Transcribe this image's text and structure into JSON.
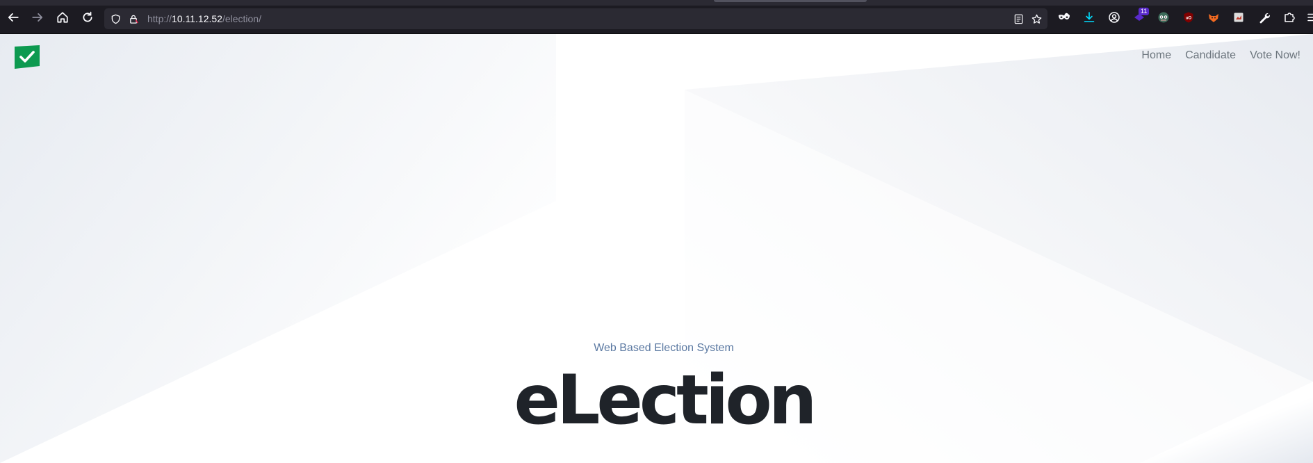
{
  "browser": {
    "url_scheme": "http://",
    "url_host": "10.11.12.52",
    "url_path": "/election/",
    "extension_badge": "11"
  },
  "nav": {
    "home": "Home",
    "candidate": "Candidate",
    "vote_now": "Vote Now!"
  },
  "hero": {
    "subtitle": "Web Based Election System",
    "title": "eLection"
  },
  "colors": {
    "brand_green": "#0d9a50",
    "nav_text": "#6c757d",
    "subtitle": "#5a78a1",
    "title": "#1f2329"
  },
  "icons": [
    "back-icon",
    "forward-icon",
    "home-icon",
    "reload-icon",
    "shield-icon",
    "lock-icon",
    "reader-icon",
    "star-icon",
    "mask-icon",
    "download-icon",
    "account-icon",
    "extension-icons",
    "wrench-icon",
    "puzzle-icon",
    "menu-icon"
  ]
}
